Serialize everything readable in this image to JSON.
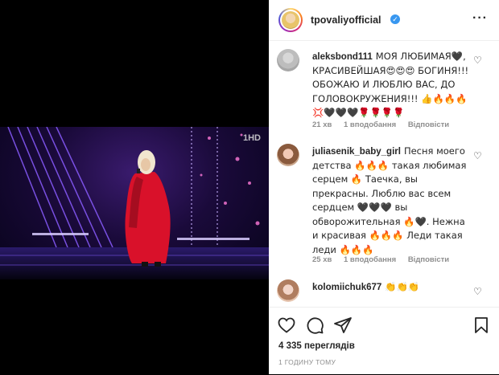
{
  "post": {
    "username": "tpovaliyofficial",
    "verified_icon": "verified-badge-icon",
    "more_icon": "more-options-icon",
    "channel_logo": "1HD"
  },
  "comments": [
    {
      "username": "aleksbond111",
      "text": "МОЯ ЛЮБИМАЯ🖤, КРАСИВЕЙШАЯ😍😍😍 БОГИНЯ!!! ОБОЖАЮ И ЛЮБЛЮ ВАС, ДО ГОЛОВОКРУЖЕНИЯ!!! 👍🔥🔥🔥💢🖤🖤🖤🌹🌹🌹🌹",
      "time": "21 хв",
      "likes": "1 вподобання",
      "reply": "Відповісти"
    },
    {
      "username": "juliasenik_baby_girl",
      "text": "Песня моего детства 🔥🔥🔥 такая любимая серцем 🔥 Таечка, вы прекрасны. Люблю вас всем сердцем 🖤🖤🖤 вы обворожительная 🔥🖤. Нежна и красивая 🔥🔥🔥 Леди такая леди 🔥🔥🔥",
      "time": "25 хв",
      "likes": "1 вподобання",
      "reply": "Відповісти"
    },
    {
      "username": "kolomiichuk677",
      "text": "👏👏👏"
    }
  ],
  "actions": {
    "views": "4 335 переглядів",
    "time": "1 ГОДИНУ ТОМУ"
  },
  "colors": {
    "accent": "#3897f0",
    "meta": "#8e8e8e",
    "text": "#262626"
  }
}
